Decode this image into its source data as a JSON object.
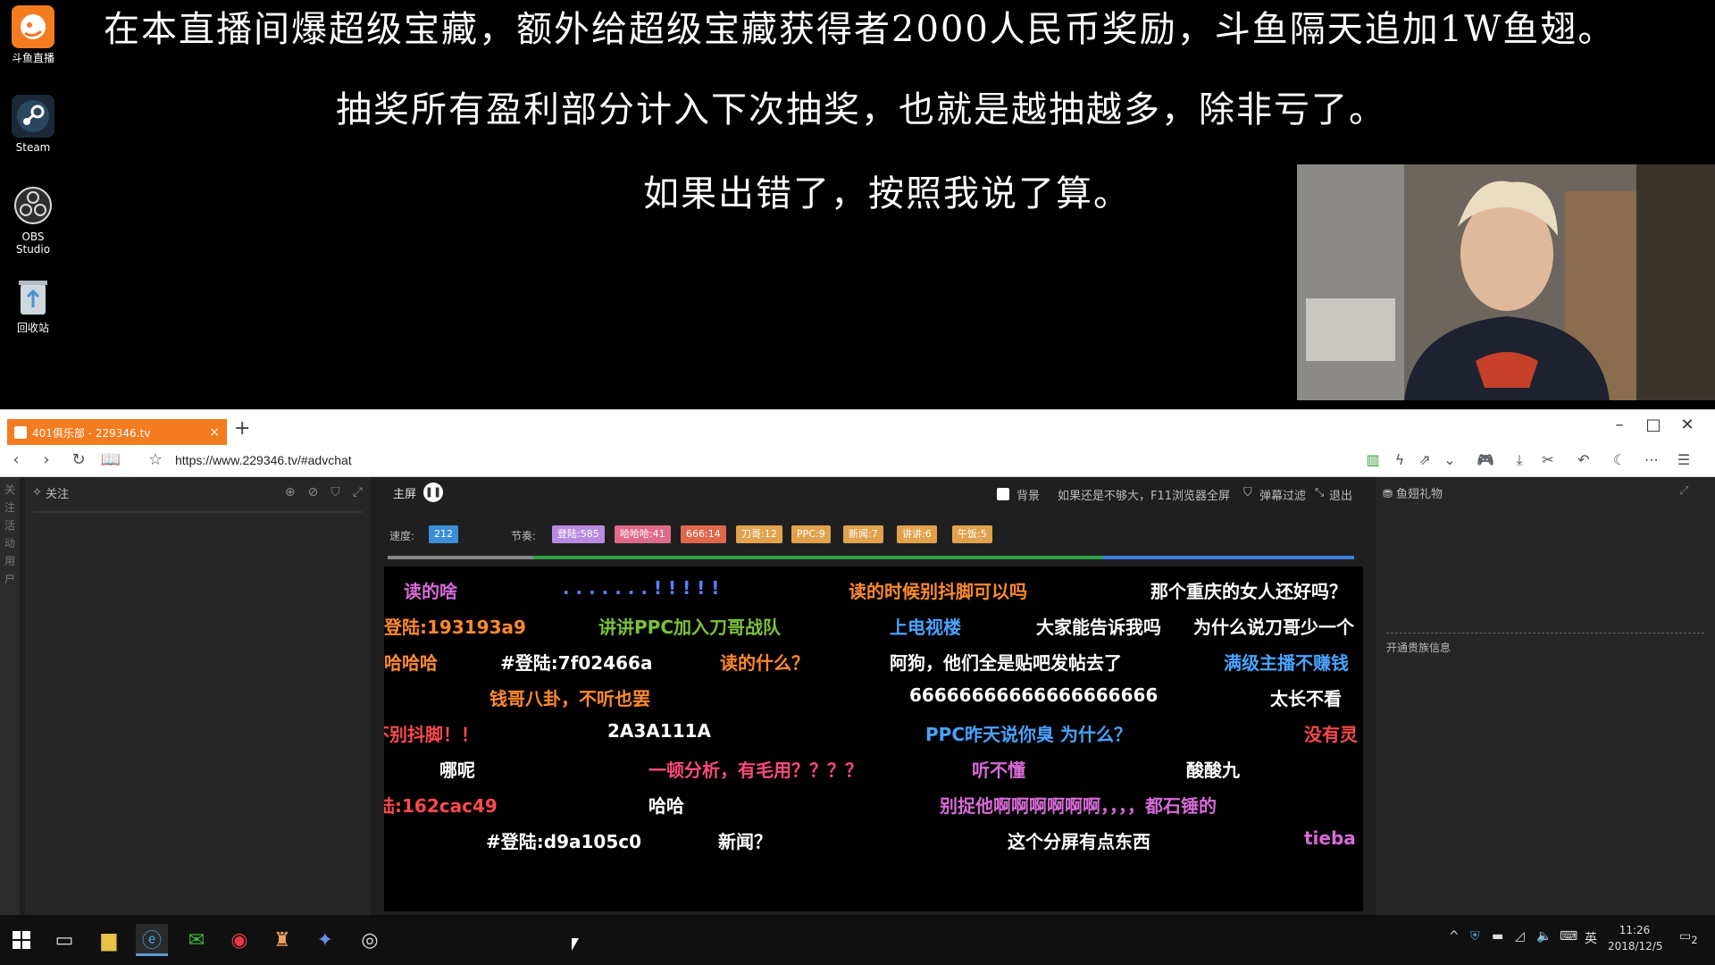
{
  "desktop": {
    "icons": [
      {
        "label": "斗鱼直播",
        "icon": "douyu-icon"
      },
      {
        "label": "Steam",
        "icon": "steam-icon"
      },
      {
        "label": "OBS Studio",
        "icon": "obs-icon"
      },
      {
        "label": "回收站",
        "icon": "recycle-bin-icon"
      }
    ],
    "overlay_lines": [
      "在本直播间爆超级宝藏，额外给超级宝藏获得者2000人民币奖励，斗鱼隔天追加1W鱼翅。",
      "抽奖所有盈利部分计入下次抽奖，也就是越抽越多，除非亏了。",
      "如果出错了，按照我说了算。"
    ]
  },
  "browser": {
    "tab_title": "401俱乐部 - 229346.tv",
    "tab_close": "×",
    "new_tab": "+",
    "window_controls": {
      "minimize": "–",
      "maximize": "□",
      "close": "✕"
    },
    "url": "https://www.229346.tv/#advchat"
  },
  "page": {
    "left_rail": [
      "关",
      "注",
      "活",
      "动",
      "用",
      "户"
    ],
    "follow_title": "关注",
    "chat": {
      "title": "主屏",
      "background_label": "背景",
      "hint": "如果还是不够大，F11浏览器全屏",
      "filter_label": "弹幕过滤",
      "exit_label": "退出",
      "speed_label": "速度:",
      "speed_value": "212",
      "rhythm_label": "节奏:",
      "badges": [
        {
          "text": "登陆:585",
          "color": "#b98be0"
        },
        {
          "text": "哈哈哈:41",
          "color": "#e06a8b"
        },
        {
          "text": "666:14",
          "color": "#e0674c"
        },
        {
          "text": "刀哥:12",
          "color": "#e0a24c"
        },
        {
          "text": "PPC:9",
          "color": "#e0a24c"
        },
        {
          "text": "新闻:7",
          "color": "#e0a24c"
        },
        {
          "text": "讲讲:6",
          "color": "#e0a24c"
        },
        {
          "text": "午饭:5",
          "color": "#e0a24c"
        }
      ],
      "danmu": [
        {
          "text": "读的啥",
          "color": "#d96ad9"
        },
        {
          "text": ". . . . . . . ! ! ! ! !",
          "color": "#5b7fff"
        },
        {
          "text": "读的时候别抖脚可以吗",
          "color": "#ff8a2a"
        },
        {
          "text": "那个重庆的女人还好吗？",
          "color": "#ffffff"
        },
        {
          "text": "登陆:193193a9",
          "color": "#ff8a2a"
        },
        {
          "text": "讲讲PPC加入刀哥战队",
          "color": "#7cc23a"
        },
        {
          "text": "上电视楼",
          "color": "#4aa3ff"
        },
        {
          "text": "大家能告诉我吗",
          "color": "#ffffff"
        },
        {
          "text": "为什么说刀哥少一个",
          "color": "#ffffff"
        },
        {
          "text": "哈哈哈",
          "color": "#ff8a2a"
        },
        {
          "text": "#登陆:7f02466a",
          "color": "#ffffff"
        },
        {
          "text": "读的什么？",
          "color": "#ff8a2a"
        },
        {
          "text": "阿狗，他们全是贴吧发帖去了",
          "color": "#ffffff"
        },
        {
          "text": "满级主播不赚钱",
          "color": "#4aa3ff"
        },
        {
          "text": "钱哥八卦，不听也罢",
          "color": "#ff8a2a"
        },
        {
          "text": "66666666666666666666",
          "color": "#ffffff"
        },
        {
          "text": "太长不看",
          "color": "#ffffff"
        },
        {
          "text": "不别抖脚！！",
          "color": "#ff4a4a"
        },
        {
          "text": "2A3A111A",
          "color": "#ffffff"
        },
        {
          "text": "PPC昨天说你臭 为什么？",
          "color": "#4aa3ff"
        },
        {
          "text": "没有灵",
          "color": "#ff4a4a"
        },
        {
          "text": "哪呢",
          "color": "#ffffff"
        },
        {
          "text": "一顿分析，有毛用？？？？",
          "color": "#ff4a7a"
        },
        {
          "text": "听不懂",
          "color": "#d96ad9"
        },
        {
          "text": "酸酸九",
          "color": "#ffffff"
        },
        {
          "text": "陆:162cac49",
          "color": "#ff4a4a"
        },
        {
          "text": "哈哈",
          "color": "#ffffff"
        },
        {
          "text": "别捉他啊啊啊啊啊啊，，，，都石锤的",
          "color": "#d96ad9"
        },
        {
          "text": "#登陆:d9a105c0",
          "color": "#ffffff"
        },
        {
          "text": "新闻？",
          "color": "#ffffff"
        },
        {
          "text": "这个分屏有点东西",
          "color": "#ffffff"
        },
        {
          "text": "tieba",
          "color": "#d96ad9"
        }
      ]
    },
    "gift": {
      "title": "鱼翅礼物",
      "noble_label": "开通贵族信息"
    }
  },
  "taskbar": {
    "time": "11:26",
    "date": "2018/12/5",
    "ime": "英",
    "notifications": "2"
  }
}
